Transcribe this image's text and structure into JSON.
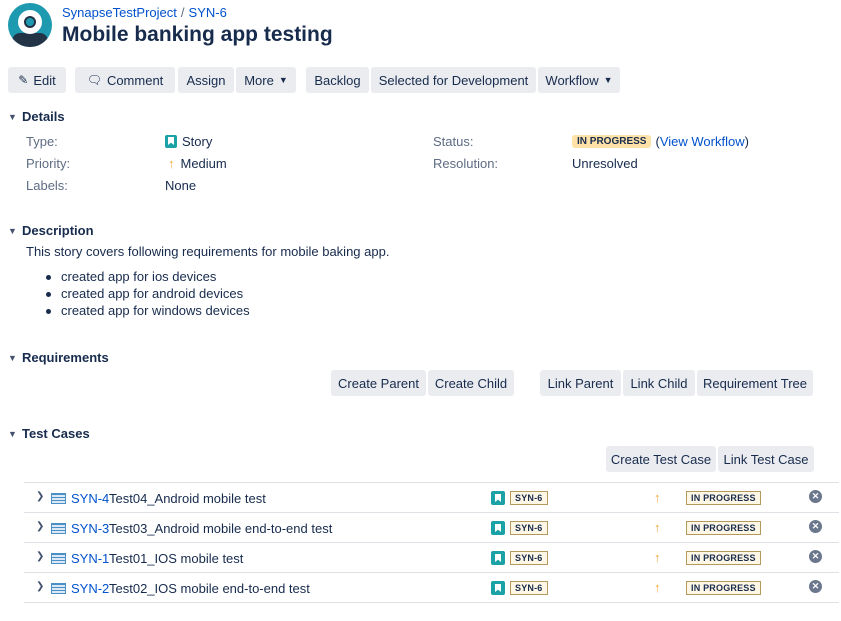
{
  "header": {
    "project": "SynapseTestProject",
    "separator": "/",
    "issue_key": "SYN-6",
    "title": "Mobile banking app testing"
  },
  "toolbar": {
    "edit": "Edit",
    "comment": "Comment",
    "assign": "Assign",
    "more": "More",
    "backlog": "Backlog",
    "selected_for_development": "Selected for Development",
    "workflow": "Workflow"
  },
  "details": {
    "heading": "Details",
    "type_label": "Type:",
    "type_value": "Story",
    "priority_label": "Priority:",
    "priority_value": "Medium",
    "labels_label": "Labels:",
    "labels_value": "None",
    "status_label": "Status:",
    "status_value": "IN PROGRESS",
    "view_workflow_open": "(",
    "view_workflow": "View Workflow",
    "view_workflow_close": ")",
    "resolution_label": "Resolution:",
    "resolution_value": "Unresolved"
  },
  "description": {
    "heading": "Description",
    "text": "This story covers following requirements for mobile baking app.",
    "items": [
      "created app for ios devices",
      "created app for android devices",
      "created app for windows devices"
    ]
  },
  "requirements": {
    "heading": "Requirements",
    "buttons": [
      "Create Parent",
      "Create Child",
      "Link Parent",
      "Link Child",
      "Requirement Tree"
    ]
  },
  "test_cases": {
    "heading": "Test Cases",
    "buttons": [
      "Create Test Case",
      "Link Test Case"
    ],
    "rows": [
      {
        "key": "SYN-4",
        "summary": "Test04_Android mobile test",
        "parent": "SYN-6",
        "status": "IN PROGRESS"
      },
      {
        "key": "SYN-3",
        "summary": "Test03_Android mobile end-to-end test",
        "parent": "SYN-6",
        "status": "IN PROGRESS"
      },
      {
        "key": "SYN-1",
        "summary": "Test01_IOS mobile test",
        "parent": "SYN-6",
        "status": "IN PROGRESS"
      },
      {
        "key": "SYN-2",
        "summary": "Test02_IOS mobile end-to-end test",
        "parent": "SYN-6",
        "status": "IN PROGRESS"
      }
    ]
  },
  "icons": {
    "edit": "pencil-icon",
    "comment": "speech-bubble-icon",
    "story": "story-icon",
    "priority_medium": "arrow-up-icon",
    "test_case": "test-case-icon",
    "remove": "remove-icon"
  },
  "colors": {
    "accent": "#0052cc",
    "status_in_progress": "#ffe2a8",
    "story": "#1ba2a6",
    "priority_medium": "#f2a93b"
  }
}
